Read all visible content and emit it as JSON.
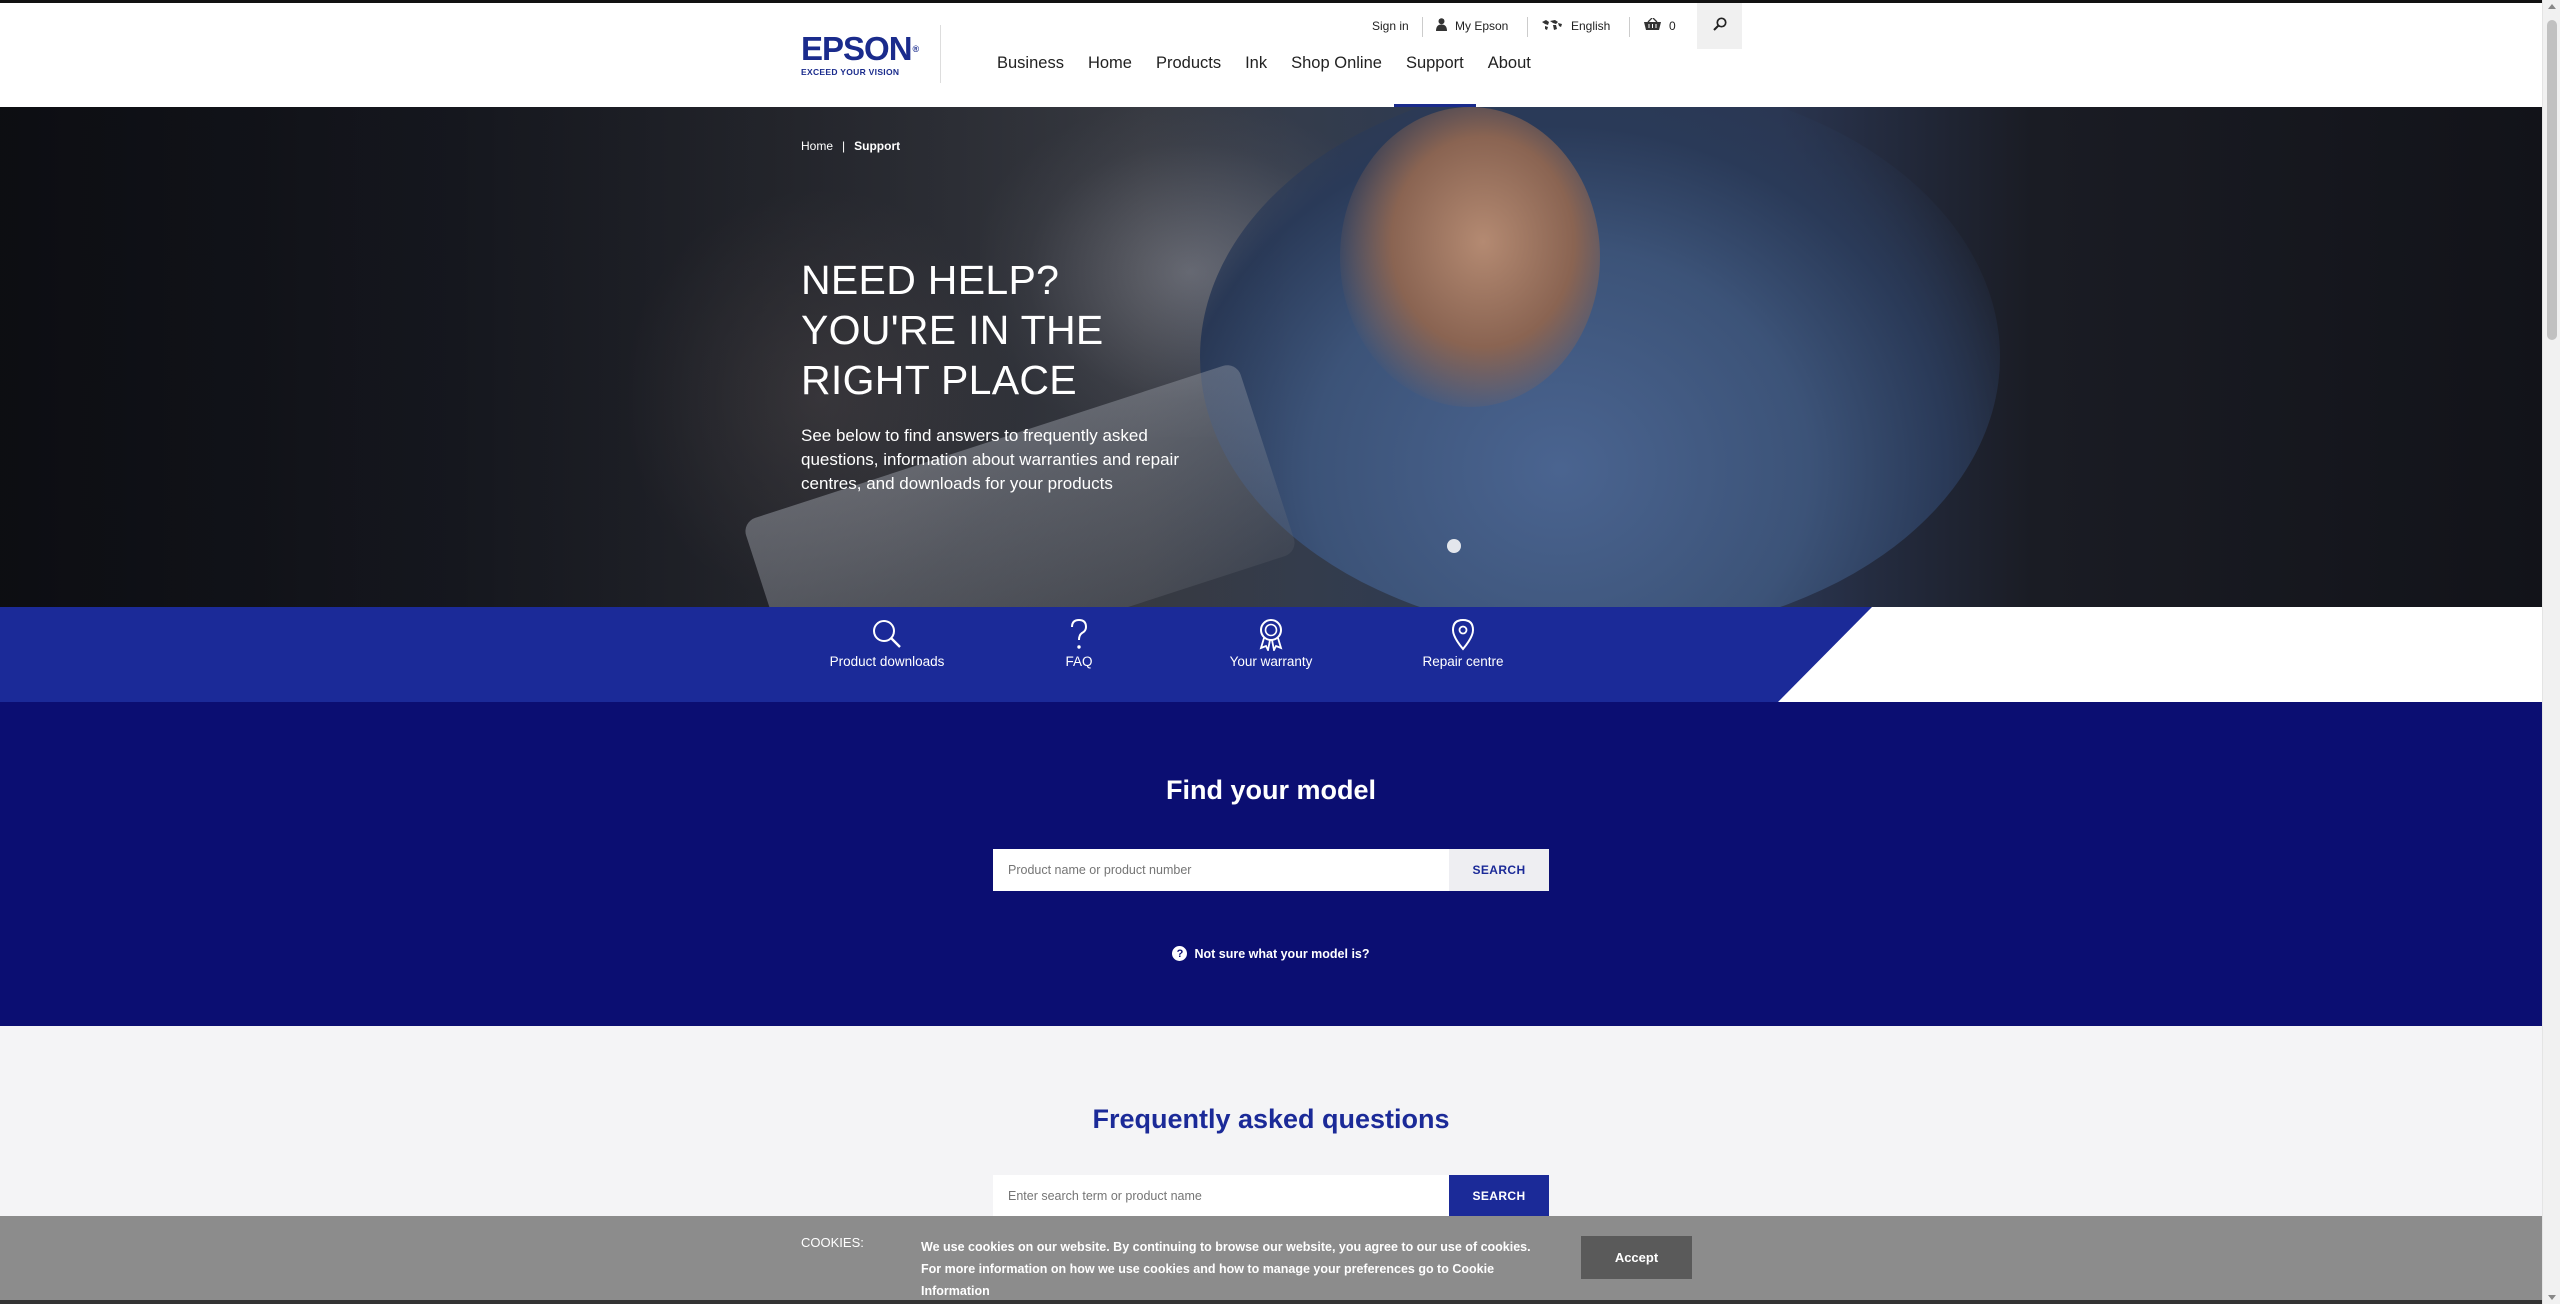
{
  "header": {
    "logo": {
      "word": "EPSON",
      "tagline": "EXCEED YOUR VISION"
    },
    "utility": {
      "sign_in": "Sign in",
      "my_epson": "My Epson",
      "language": "English",
      "cart_count": "0"
    },
    "nav": [
      "Business",
      "Home",
      "Products",
      "Ink",
      "Shop Online",
      "Support",
      "About"
    ],
    "active_nav": "Support"
  },
  "hero": {
    "breadcrumb": [
      "Home",
      "Support"
    ],
    "title": "NEED HELP? YOU'RE IN THE RIGHT PLACE",
    "description": "See below to find answers to frequently asked questions, information about warranties and repair centres, and downloads for your products"
  },
  "quick_links": [
    {
      "label": "Product downloads",
      "icon": "search-icon"
    },
    {
      "label": "FAQ",
      "icon": "question-icon"
    },
    {
      "label": "Your warranty",
      "icon": "award-icon"
    },
    {
      "label": "Repair centre",
      "icon": "location-pin-icon"
    }
  ],
  "find_model": {
    "title": "Find your model",
    "placeholder": "Product name or product number",
    "button": "SEARCH",
    "help_link": "Not sure what your model is?"
  },
  "faq": {
    "title": "Frequently asked questions",
    "placeholder": "Enter search term or product name",
    "button": "SEARCH"
  },
  "cookie": {
    "label": "COOKIES:",
    "text": "We use cookies on our website. By continuing to browse our website, you agree to our use of cookies. For more information on how we use cookies and how to manage your preferences go to",
    "link": "Cookie Information",
    "accept": "Accept"
  },
  "colors": {
    "brand_blue": "#1b2a98",
    "dark_blue": "#0b0e72",
    "cookie_grey": "#8c8c8c"
  }
}
